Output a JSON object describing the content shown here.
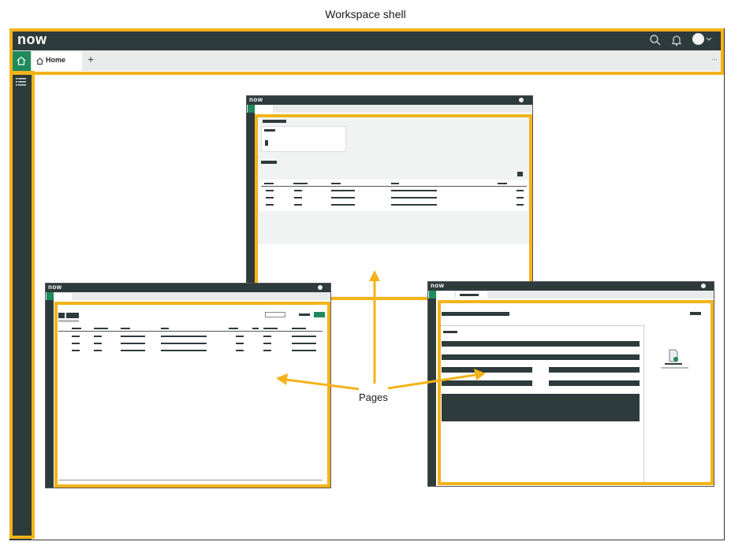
{
  "title": "Workspace shell",
  "pages_label": "Pages",
  "shell": {
    "logo": "now",
    "tab_label": "Home",
    "add_tab": "+",
    "more": "···",
    "second_tab": "×"
  },
  "colors": {
    "highlight": "#f4b31a",
    "chrome_dark": "#2e3b3c",
    "accent_green": "#1f8a5b"
  }
}
